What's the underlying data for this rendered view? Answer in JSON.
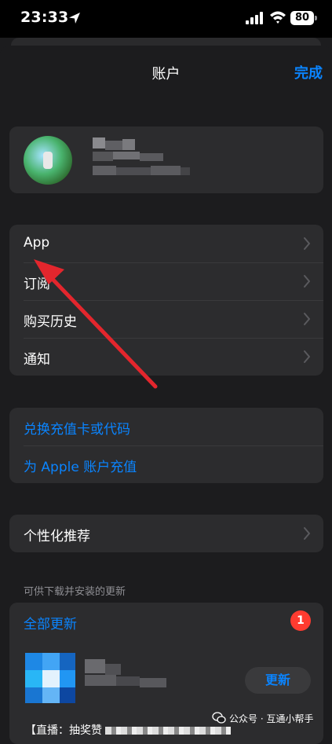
{
  "status_bar": {
    "time": "23:33",
    "battery": "80"
  },
  "nav": {
    "title": "账户",
    "done": "完成"
  },
  "menu_items": [
    {
      "label": "App"
    },
    {
      "label": "订阅"
    },
    {
      "label": "购买历史"
    },
    {
      "label": "通知"
    }
  ],
  "redeem": {
    "redeem_code": "兑换充值卡或代码",
    "add_funds": "为 Apple 账户充值"
  },
  "personalized": {
    "label": "个性化推荐"
  },
  "updates": {
    "section_caption": "可供下载并安装的更新",
    "update_all": "全部更新",
    "badge_count": "1",
    "update_button": "更新",
    "app_description_start": "【直播：抽奖赞"
  },
  "watermark": {
    "text": "公众号 · 互通小帮手"
  },
  "colors": {
    "accent": "#0a84ff",
    "badge": "#ff3b30",
    "annotation_arrow": "#e3262d"
  }
}
